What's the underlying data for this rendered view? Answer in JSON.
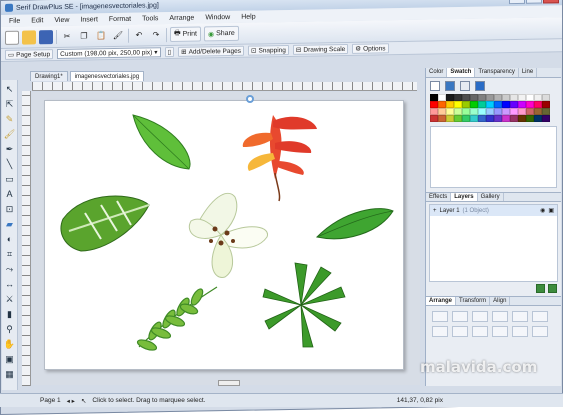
{
  "window": {
    "title": "Serif DrawPlus SE - [imagenesvectoriales.jpg]",
    "controls": {
      "minimize": "–",
      "maximize": "□",
      "close": "x"
    }
  },
  "menu": [
    "File",
    "Edit",
    "View",
    "Insert",
    "Format",
    "Tools",
    "Arrange",
    "Window",
    "Help"
  ],
  "toolbar": {
    "print_label": "Print",
    "share_label": "Share"
  },
  "toolbar2": {
    "page_setup_label": "Page Setup",
    "page_size_value": "Custom (198,00 pix, 250,00 pix)",
    "add_delete_pages_label": "Add/Delete Pages",
    "snapping_label": "Snapping",
    "drawing_scale_label": "Drawing Scale",
    "options_label": "Options"
  },
  "doc_tabs": [
    {
      "label": "Drawing1*"
    },
    {
      "label": "imagenesvectoriales.jpg"
    }
  ],
  "right_panel": {
    "top_tabs": [
      "Color",
      "Swatch",
      "Transparency",
      "Line"
    ],
    "active_top_tab": "Swatch",
    "swatch_colors": [
      "#000000",
      "#ffffff",
      "#1a1a1a",
      "#333333",
      "#4d4d4d",
      "#666666",
      "#808080",
      "#999999",
      "#b3b3b3",
      "#cccccc",
      "#e6e6e6",
      "#f2f2f2",
      "#ffffff",
      "#f0f0f0",
      "#dcdcdc",
      "#ff0000",
      "#ff6600",
      "#ffcc00",
      "#ffff00",
      "#99cc00",
      "#00cc00",
      "#00cc99",
      "#00ccff",
      "#0066ff",
      "#0000ff",
      "#6600ff",
      "#cc00ff",
      "#ff00cc",
      "#ff0066",
      "#990000",
      "#ff9999",
      "#ffcc99",
      "#ffff99",
      "#ccff99",
      "#99ff99",
      "#99ffcc",
      "#99ffff",
      "#99ccff",
      "#9999ff",
      "#cc99ff",
      "#ff99ff",
      "#ff99cc",
      "#cc6666",
      "#996633",
      "#666633",
      "#cc3333",
      "#cc6633",
      "#cccc33",
      "#66cc33",
      "#33cc66",
      "#33cccc",
      "#3366cc",
      "#3333cc",
      "#6633cc",
      "#cc33cc",
      "#993366",
      "#663300",
      "#336600",
      "#003366",
      "#330066"
    ],
    "effects_tabs": [
      "Effects",
      "Layers",
      "Gallery"
    ],
    "active_effects_tab": "Layers",
    "layer_name": "Layer 1",
    "layer_objects": "(1 Object)",
    "arrange_tabs": [
      "Arrange",
      "Transform",
      "Align"
    ],
    "active_arrange_tab": "Arrange"
  },
  "status": {
    "page_label": "Page 1",
    "hint": "Click to select. Drag to marquee select.",
    "coords": "141,37, 0,82 pix"
  },
  "watermark": "malavida.com"
}
